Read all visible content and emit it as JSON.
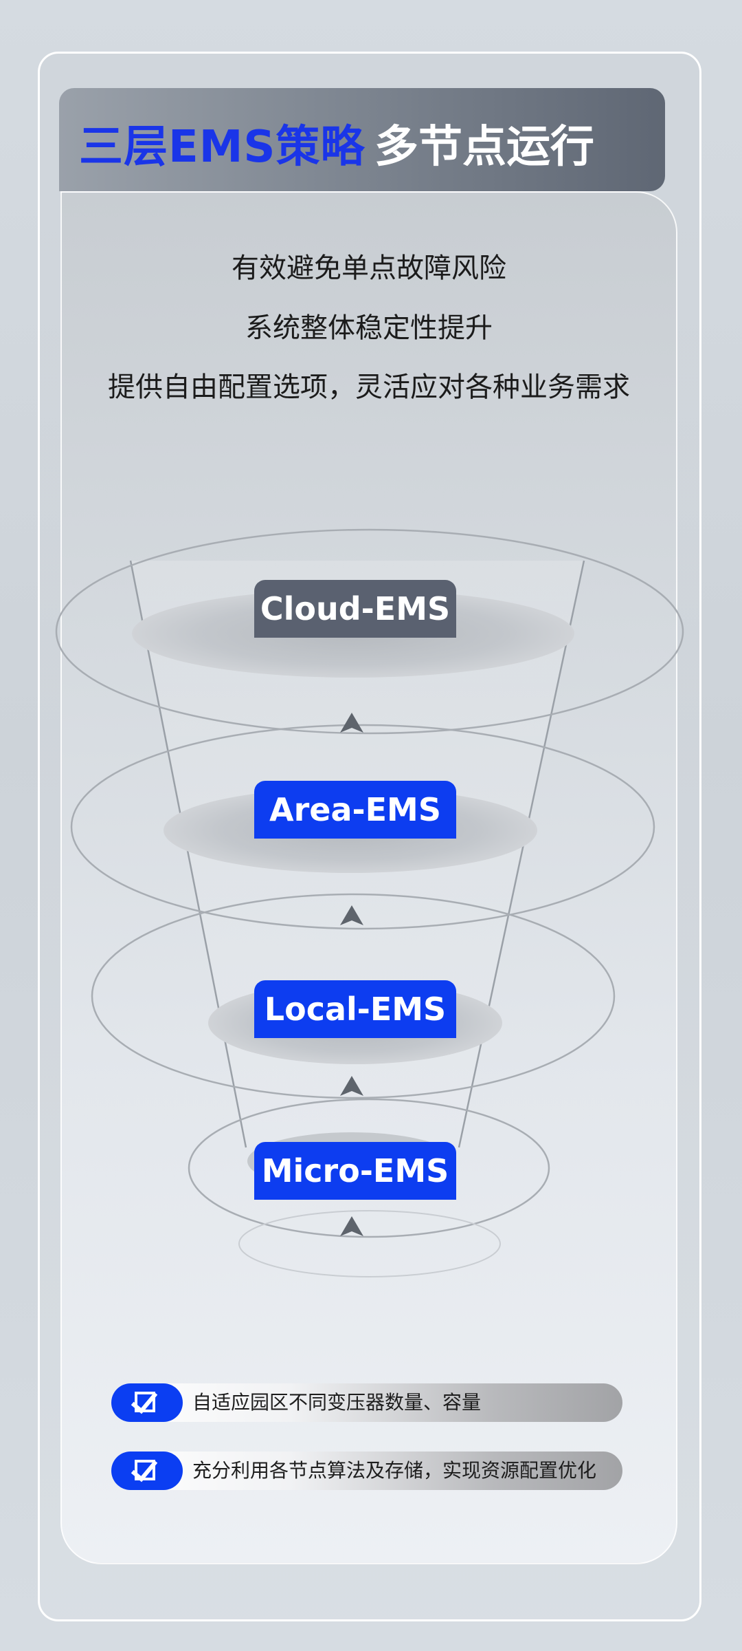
{
  "header": {
    "title_blue": "三层EMS策略",
    "title_white": "多节点运行"
  },
  "intro": {
    "lines": [
      "有效避免单点故障风险",
      "系统整体稳定性提升",
      "提供自由配置选项，灵活应对各种业务需求"
    ]
  },
  "diagram": {
    "tiers": [
      {
        "label": "Cloud-EMS",
        "color": "#5a6170"
      },
      {
        "label": "Area-EMS",
        "color": "#0d3df0"
      },
      {
        "label": "Local-EMS",
        "color": "#0d3df0"
      },
      {
        "label": "Micro-EMS",
        "color": "#0d3df0"
      }
    ],
    "arrow_direction": "up"
  },
  "features": [
    {
      "icon": "checkbox-icon",
      "text": "自适应园区不同变压器数量、容量"
    },
    {
      "icon": "checkbox-icon",
      "text": "充分利用各节点算法及存储，实现资源配置优化"
    }
  ],
  "colors": {
    "accent_blue": "#0d3df0",
    "header_gray": "#5f6774",
    "cloud_gray": "#5a6170"
  }
}
